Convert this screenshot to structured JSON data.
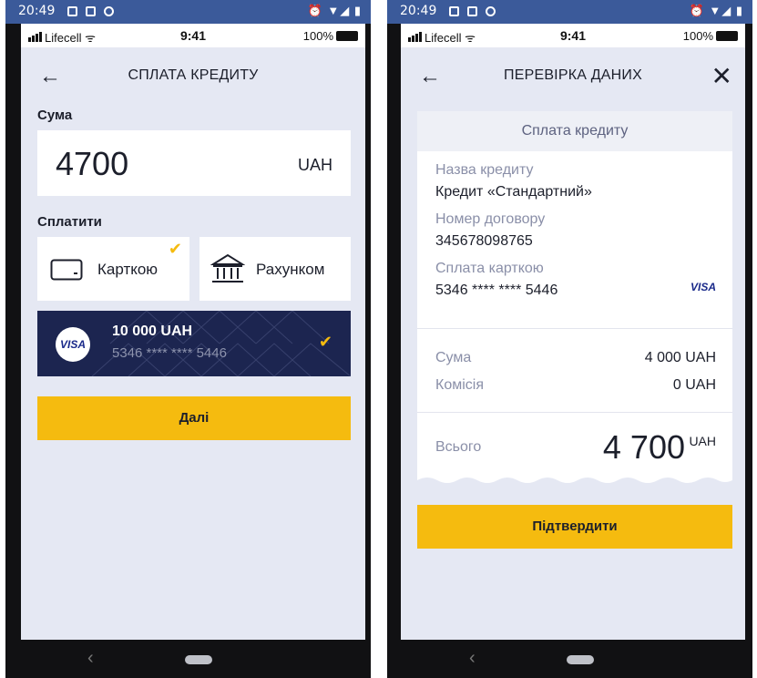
{
  "left": {
    "android_status": {
      "time": "20:49",
      "right_icons": "⏰ ▼◢ ▮"
    },
    "ios_status": {
      "carrier": "Lifecell",
      "time": "9:41",
      "battery": "100%"
    },
    "nav": {
      "title": "СПЛАТА КРЕДИТУ",
      "back": "←"
    },
    "sum": {
      "label": "Сума",
      "value": "4700",
      "currency": "UAH"
    },
    "pay": {
      "label": "Сплатити",
      "options": [
        {
          "label": "Карткою",
          "selected": true
        },
        {
          "label": "Рахунком",
          "selected": false
        }
      ]
    },
    "card": {
      "brand": "VISA",
      "amount": "10 000 UAH",
      "number": "5346 **** **** 5446",
      "check": "✔"
    },
    "next_button": "Далі",
    "check_mark": "✔"
  },
  "right": {
    "android_status": {
      "time": "20:49",
      "right_icons": "⏰ ▼◢ ▮"
    },
    "ios_status": {
      "carrier": "Lifecell",
      "time": "9:41",
      "battery": "100%"
    },
    "nav": {
      "title": "ПЕРЕВІРКА ДАНИХ",
      "back": "←",
      "close": "✕"
    },
    "receipt": {
      "header": "Сплата кредиту",
      "loan_name_label": "Назва кредиту",
      "loan_name_value": "Кредит «Стандартний»",
      "contract_label": "Номер договору",
      "contract_value": "345678098765",
      "card_label": "Сплата карткою",
      "card_value": "5346 **** **** 5446",
      "card_brand": "VISA",
      "sum_label": "Сума",
      "sum_value": "4 000 UAH",
      "fee_label": "Комісія",
      "fee_value": "0 UAH",
      "total_label": "Всього",
      "total_value": "4 700",
      "total_currency": "UAH"
    },
    "confirm_button": "Підтвердити"
  },
  "android_nav": {
    "back": "‹"
  },
  "colors": {
    "accent": "#f5bb0f",
    "card_bg": "#1c2550",
    "app_bg": "#e5e8f3",
    "android_bar": "#3b5a9a"
  }
}
